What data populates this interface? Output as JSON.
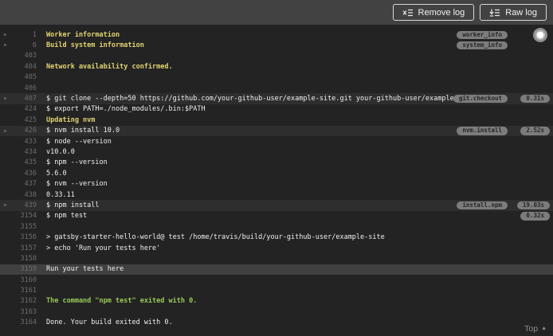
{
  "toolbar": {
    "remove_log_label": "Remove log",
    "raw_log_label": "Raw log"
  },
  "icons": {
    "remove_log": "x-list-icon",
    "raw_log": "download-list-icon",
    "fold_glyph": "▶",
    "top_glyph": "▲",
    "follow_log": "follow-log-dot-icon"
  },
  "colors": {
    "toolbar_bg": "#424242",
    "log_bg": "#232323",
    "fold_row_bg": "#2e2e2e",
    "highlight_row_bg": "#404040",
    "yellow": "#e3d472",
    "green": "#99ca57",
    "text": "#f0f0f0",
    "line_number": "#6d6d6d",
    "badge_bg": "#7c7c7c",
    "badge_text": "#262626"
  },
  "log": {
    "top_link_label": "Top",
    "rows": [
      {
        "n": "1",
        "text": "Worker information",
        "style": "yellow",
        "fold": true,
        "label_badge": "worker_info",
        "time_badge": ""
      },
      {
        "n": "6",
        "text": "Build system information",
        "style": "yellow",
        "fold": true,
        "label_badge": "system_info",
        "time_badge": ""
      },
      {
        "n": "403",
        "text": "",
        "style": "",
        "fold": false,
        "label_badge": "",
        "time_badge": ""
      },
      {
        "n": "404",
        "text": "Network availability confirmed.",
        "style": "yellow",
        "fold": false,
        "label_badge": "",
        "time_badge": ""
      },
      {
        "n": "405",
        "text": "",
        "style": "",
        "fold": false,
        "label_badge": "",
        "time_badge": ""
      },
      {
        "n": "406",
        "text": "",
        "style": "",
        "fold": false,
        "label_badge": "",
        "time_badge": ""
      },
      {
        "n": "407",
        "text": "$ git clone --depth=50 https://github.com/your-github-user/example-site.git your-github-user/example-",
        "style": "",
        "fold": true,
        "row_bg": "fold",
        "label_badge": "git.checkout",
        "time_badge": "0.31s"
      },
      {
        "n": "424",
        "text": "$ export PATH=./node_modules/.bin:$PATH",
        "style": "",
        "fold": false,
        "label_badge": "",
        "time_badge": ""
      },
      {
        "n": "425",
        "text": "Updating nvm",
        "style": "yellow",
        "fold": false,
        "label_badge": "",
        "time_badge": ""
      },
      {
        "n": "426",
        "text": "$ nvm install 10.0",
        "style": "",
        "fold": true,
        "row_bg": "fold",
        "label_badge": "nvm.install",
        "time_badge": "2.52s"
      },
      {
        "n": "433",
        "text": "$ node --version",
        "style": "",
        "fold": false,
        "label_badge": "",
        "time_badge": ""
      },
      {
        "n": "434",
        "text": "v10.0.0",
        "style": "",
        "fold": false,
        "label_badge": "",
        "time_badge": ""
      },
      {
        "n": "435",
        "text": "$ npm --version",
        "style": "",
        "fold": false,
        "label_badge": "",
        "time_badge": ""
      },
      {
        "n": "436",
        "text": "5.6.0",
        "style": "",
        "fold": false,
        "label_badge": "",
        "time_badge": ""
      },
      {
        "n": "437",
        "text": "$ nvm --version",
        "style": "",
        "fold": false,
        "label_badge": "",
        "time_badge": ""
      },
      {
        "n": "438",
        "text": "0.33.11",
        "style": "",
        "fold": false,
        "label_badge": "",
        "time_badge": ""
      },
      {
        "n": "439",
        "text": "$ npm install",
        "style": "",
        "fold": true,
        "row_bg": "fold",
        "label_badge": "install.npm",
        "time_badge": "19.03s"
      },
      {
        "n": "3154",
        "text": "$ npm test",
        "style": "",
        "fold": false,
        "label_badge": "",
        "time_badge": "0.32s"
      },
      {
        "n": "3155",
        "text": "",
        "style": "",
        "fold": false,
        "label_badge": "",
        "time_badge": ""
      },
      {
        "n": "3156",
        "text": "> gatsby-starter-hello-world@ test /home/travis/build/your-github-user/example-site",
        "style": "",
        "fold": false,
        "label_badge": "",
        "time_badge": ""
      },
      {
        "n": "3157",
        "text": "> echo 'Run your tests here'",
        "style": "",
        "fold": false,
        "label_badge": "",
        "time_badge": ""
      },
      {
        "n": "3158",
        "text": "",
        "style": "",
        "fold": false,
        "label_badge": "",
        "time_badge": ""
      },
      {
        "n": "3159",
        "text": "Run your tests here",
        "style": "",
        "fold": false,
        "row_bg": "highlight",
        "label_badge": "",
        "time_badge": ""
      },
      {
        "n": "3160",
        "text": "",
        "style": "",
        "fold": false,
        "label_badge": "",
        "time_badge": ""
      },
      {
        "n": "3161",
        "text": "",
        "style": "",
        "fold": false,
        "label_badge": "",
        "time_badge": ""
      },
      {
        "n": "3162",
        "text": "The command \"npm test\" exited with 0.",
        "style": "green",
        "fold": false,
        "label_badge": "",
        "time_badge": ""
      },
      {
        "n": "3163",
        "text": "",
        "style": "",
        "fold": false,
        "label_badge": "",
        "time_badge": ""
      },
      {
        "n": "3164",
        "text": "Done. Your build exited with 0.",
        "style": "",
        "fold": false,
        "label_badge": "",
        "time_badge": ""
      }
    ]
  }
}
